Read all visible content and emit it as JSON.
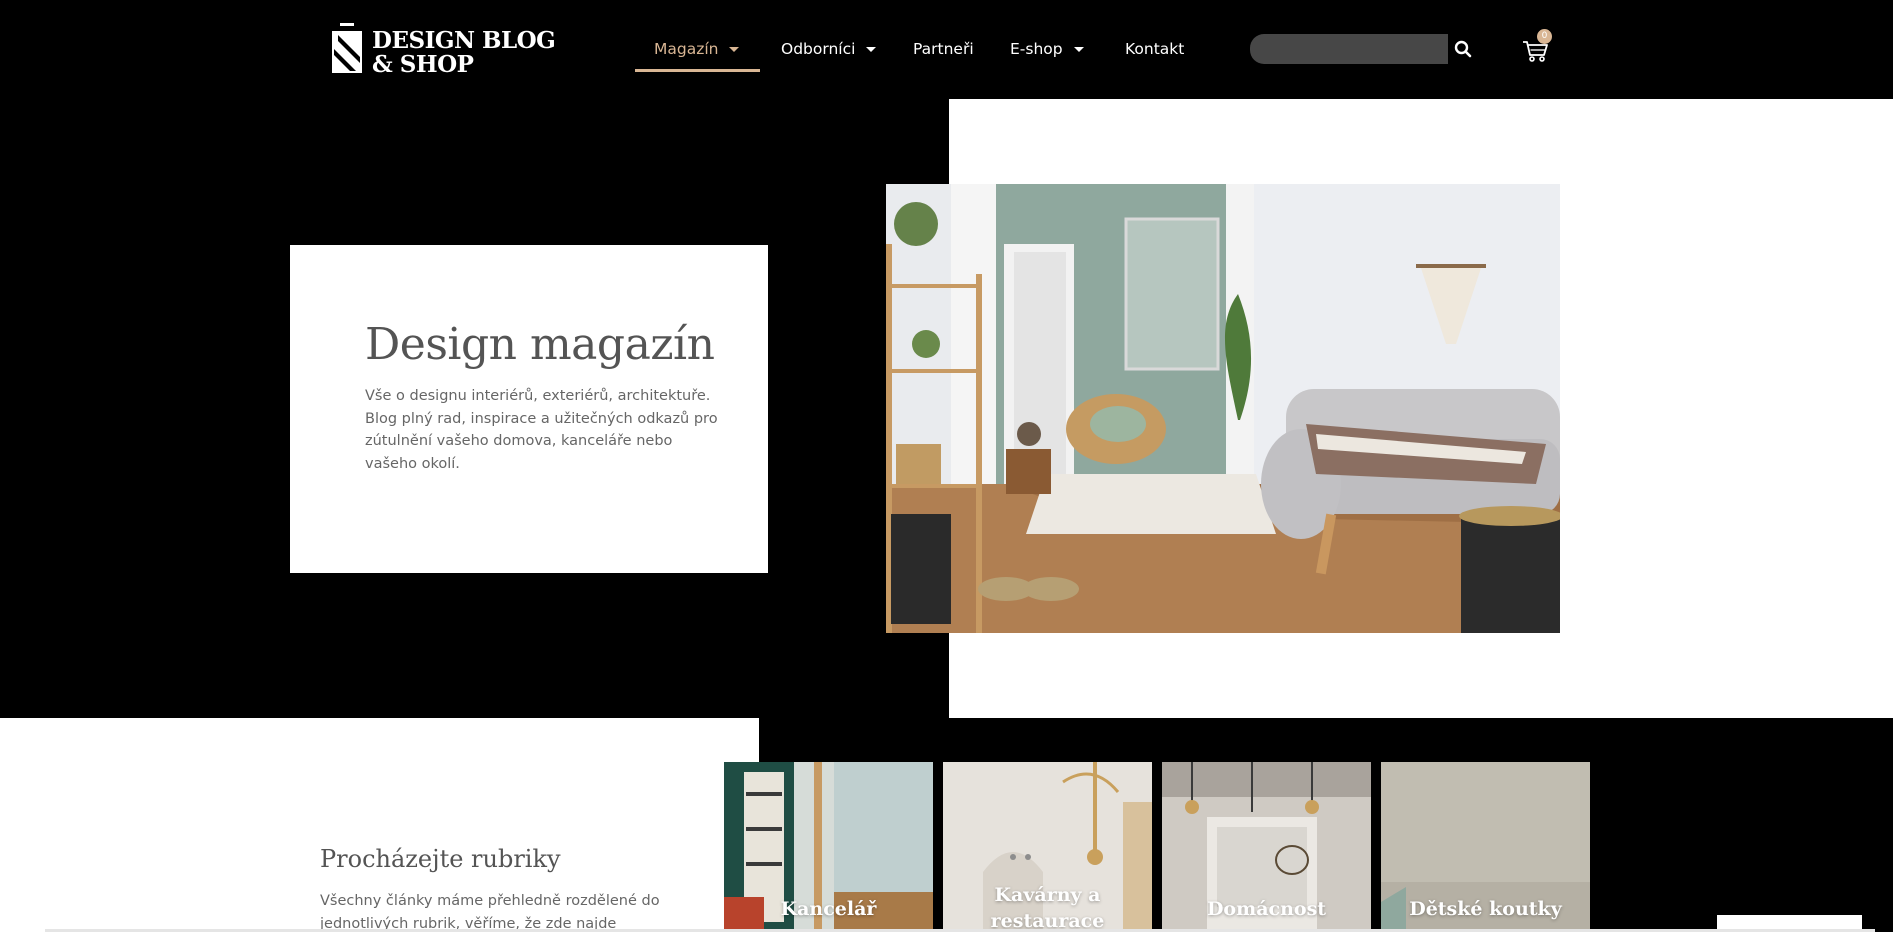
{
  "header": {
    "logo": {
      "line1": "DESIGN BLOG",
      "line2": "& SHOP"
    },
    "nav": [
      {
        "label": "Magazín",
        "has_dropdown": true,
        "active": true
      },
      {
        "label": "Odborníci",
        "has_dropdown": true,
        "active": false
      },
      {
        "label": "Partneři",
        "has_dropdown": false,
        "active": false
      },
      {
        "label": "E-shop",
        "has_dropdown": true,
        "active": false
      },
      {
        "label": "Kontakt",
        "has_dropdown": false,
        "active": false
      }
    ],
    "search": {
      "placeholder": "",
      "icon": "search-icon"
    },
    "cart": {
      "icon": "cart-icon",
      "count": "0"
    }
  },
  "hero": {
    "title": "Design magazín",
    "description": "Vše o designu interiérů, exteriérů, architektuře. Blog plný rad, inspirace a užitečných odkazů pro zútulnění vašeho domova, kanceláře nebo vašeho okolí."
  },
  "browse": {
    "title": "Procházejte rubriky",
    "description": "Všechny články máme přehledně rozdělené do jednotlivých rubrik, věříme, že zde najde inspiraci"
  },
  "categories": [
    {
      "label": "Kancelář"
    },
    {
      "label": "Kavárny a restaurace"
    },
    {
      "label": "Domácnost"
    },
    {
      "label": "Dětské koutky"
    }
  ],
  "colors": {
    "accent": "#d9b694",
    "background": "#000000",
    "card": "#ffffff",
    "text": "#545454"
  }
}
